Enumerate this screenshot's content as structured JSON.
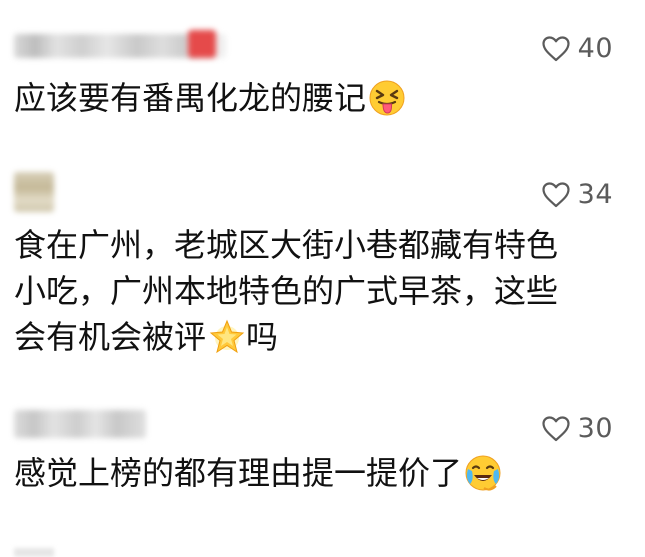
{
  "comments": [
    {
      "likes": "40",
      "text": "应该要有番禺化龙的腰记",
      "emoji": "squinting-tongue-face"
    },
    {
      "likes": "34",
      "line1": "食在广州，老城区大街小巷都藏有特色",
      "line2": "小吃，广州本地特色的广式早茶，这些",
      "line3_before": "会有机会被评",
      "emoji": "glowing-star",
      "line3_after": "吗"
    },
    {
      "likes": "30",
      "text": "感觉上榜的都有理由提一提价了",
      "emoji": "loudly-crying-laughing-face"
    }
  ],
  "colors": {
    "text": "#111111",
    "like": "#5b5b5b",
    "background": "#ffffff"
  }
}
